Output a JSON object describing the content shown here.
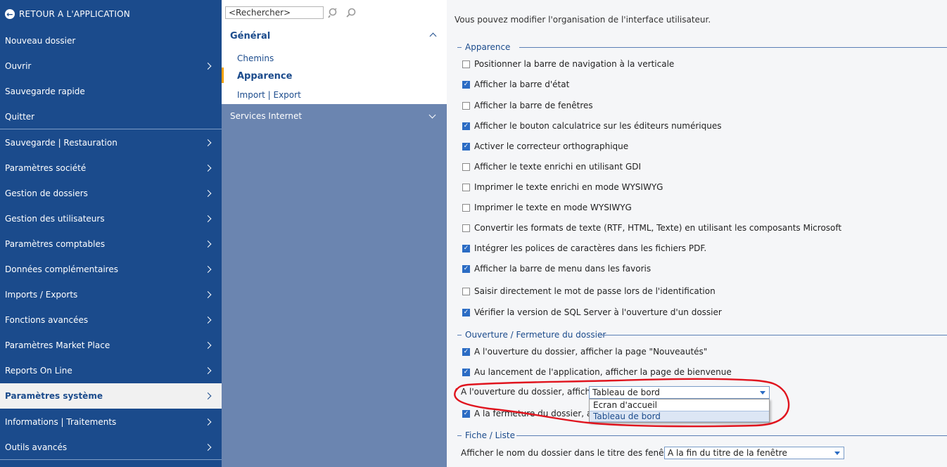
{
  "left_menu": {
    "back_label": "RETOUR A L'APPLICATION",
    "items": [
      {
        "label": "Nouveau dossier"
      },
      {
        "label": "Ouvrir"
      },
      {
        "label": "Sauvegarde rapide"
      },
      {
        "label": "Quitter"
      },
      {
        "label": "Sauvegarde | Restauration"
      },
      {
        "label": "Paramètres société"
      },
      {
        "label": "Gestion de dossiers"
      },
      {
        "label": "Gestion des utilisateurs"
      },
      {
        "label": "Paramètres comptables"
      },
      {
        "label": "Données complémentaires"
      },
      {
        "label": "Imports / Exports"
      },
      {
        "label": "Fonctions avancées"
      },
      {
        "label": "Paramètres Market Place"
      },
      {
        "label": "Reports On Line"
      },
      {
        "label": "Paramètres système",
        "active": true
      },
      {
        "label": "Informations | Traitements"
      },
      {
        "label": "Outils avancés"
      }
    ]
  },
  "nav": {
    "search_placeholder": "<Rechercher>",
    "group_title": "Général",
    "sub_items": [
      "Chemins",
      "Apparence",
      "Import | Export"
    ],
    "selected": "Apparence",
    "services_label": "Services Internet"
  },
  "content": {
    "intro": "Vous pouvez modifier l'organisation de l'interface utilisateur.",
    "sections": {
      "apparence": "Apparence",
      "ouverture": "Ouverture / Fermeture du dossier",
      "fiche": "Fiche / Liste"
    },
    "apparence_options": [
      {
        "label": "Positionner la barre de navigation à la verticale",
        "checked": false
      },
      {
        "label": "Afficher la barre d'état",
        "checked": true
      },
      {
        "label": "Afficher la barre de fenêtres",
        "checked": false
      },
      {
        "label": "Afficher le bouton calculatrice sur les éditeurs numériques",
        "checked": true
      },
      {
        "label": "Activer le correcteur orthographique",
        "checked": true
      },
      {
        "label": "Afficher le texte enrichi en utilisant GDI",
        "checked": false
      },
      {
        "label": "Imprimer le texte enrichi en mode WYSIWYG",
        "checked": false
      },
      {
        "label": "Imprimer le texte en mode WYSIWYG",
        "checked": false
      },
      {
        "label": "Convertir les formats de texte (RTF, HTML, Texte) en utilisant les composants Microsoft",
        "checked": false
      },
      {
        "label": "Intégrer les polices de caractères dans les fichiers PDF.",
        "checked": true
      },
      {
        "label": "Afficher la barre de menu dans les favoris",
        "checked": true
      },
      {
        "label": "Saisir directement le mot de passe lors de l'identification",
        "checked": false
      },
      {
        "label": "Vérifier la version de SQL Server à l'ouverture d'un dossier",
        "checked": true
      }
    ],
    "ouverture_options": [
      {
        "label": "A l'ouverture du dossier, afficher la page \"Nouveautés\"",
        "checked": true
      },
      {
        "label": "Au lancement de l'application, afficher la page de bienvenue",
        "checked": true
      }
    ],
    "open_display_label": "A l'ouverture du dossier, afficher",
    "open_display_value": "Tableau de bord",
    "open_display_options": [
      "Ecran d'accueil",
      "Tableau de bord"
    ],
    "close_option_label": "A la fermeture du dossier, affic",
    "close_option_checked": true,
    "window_title_label": "Afficher le nom du dossier dans le titre des fenêtres",
    "window_title_value": "A la fin du titre de la fenêtre"
  },
  "annotation_color": "#e0141e"
}
